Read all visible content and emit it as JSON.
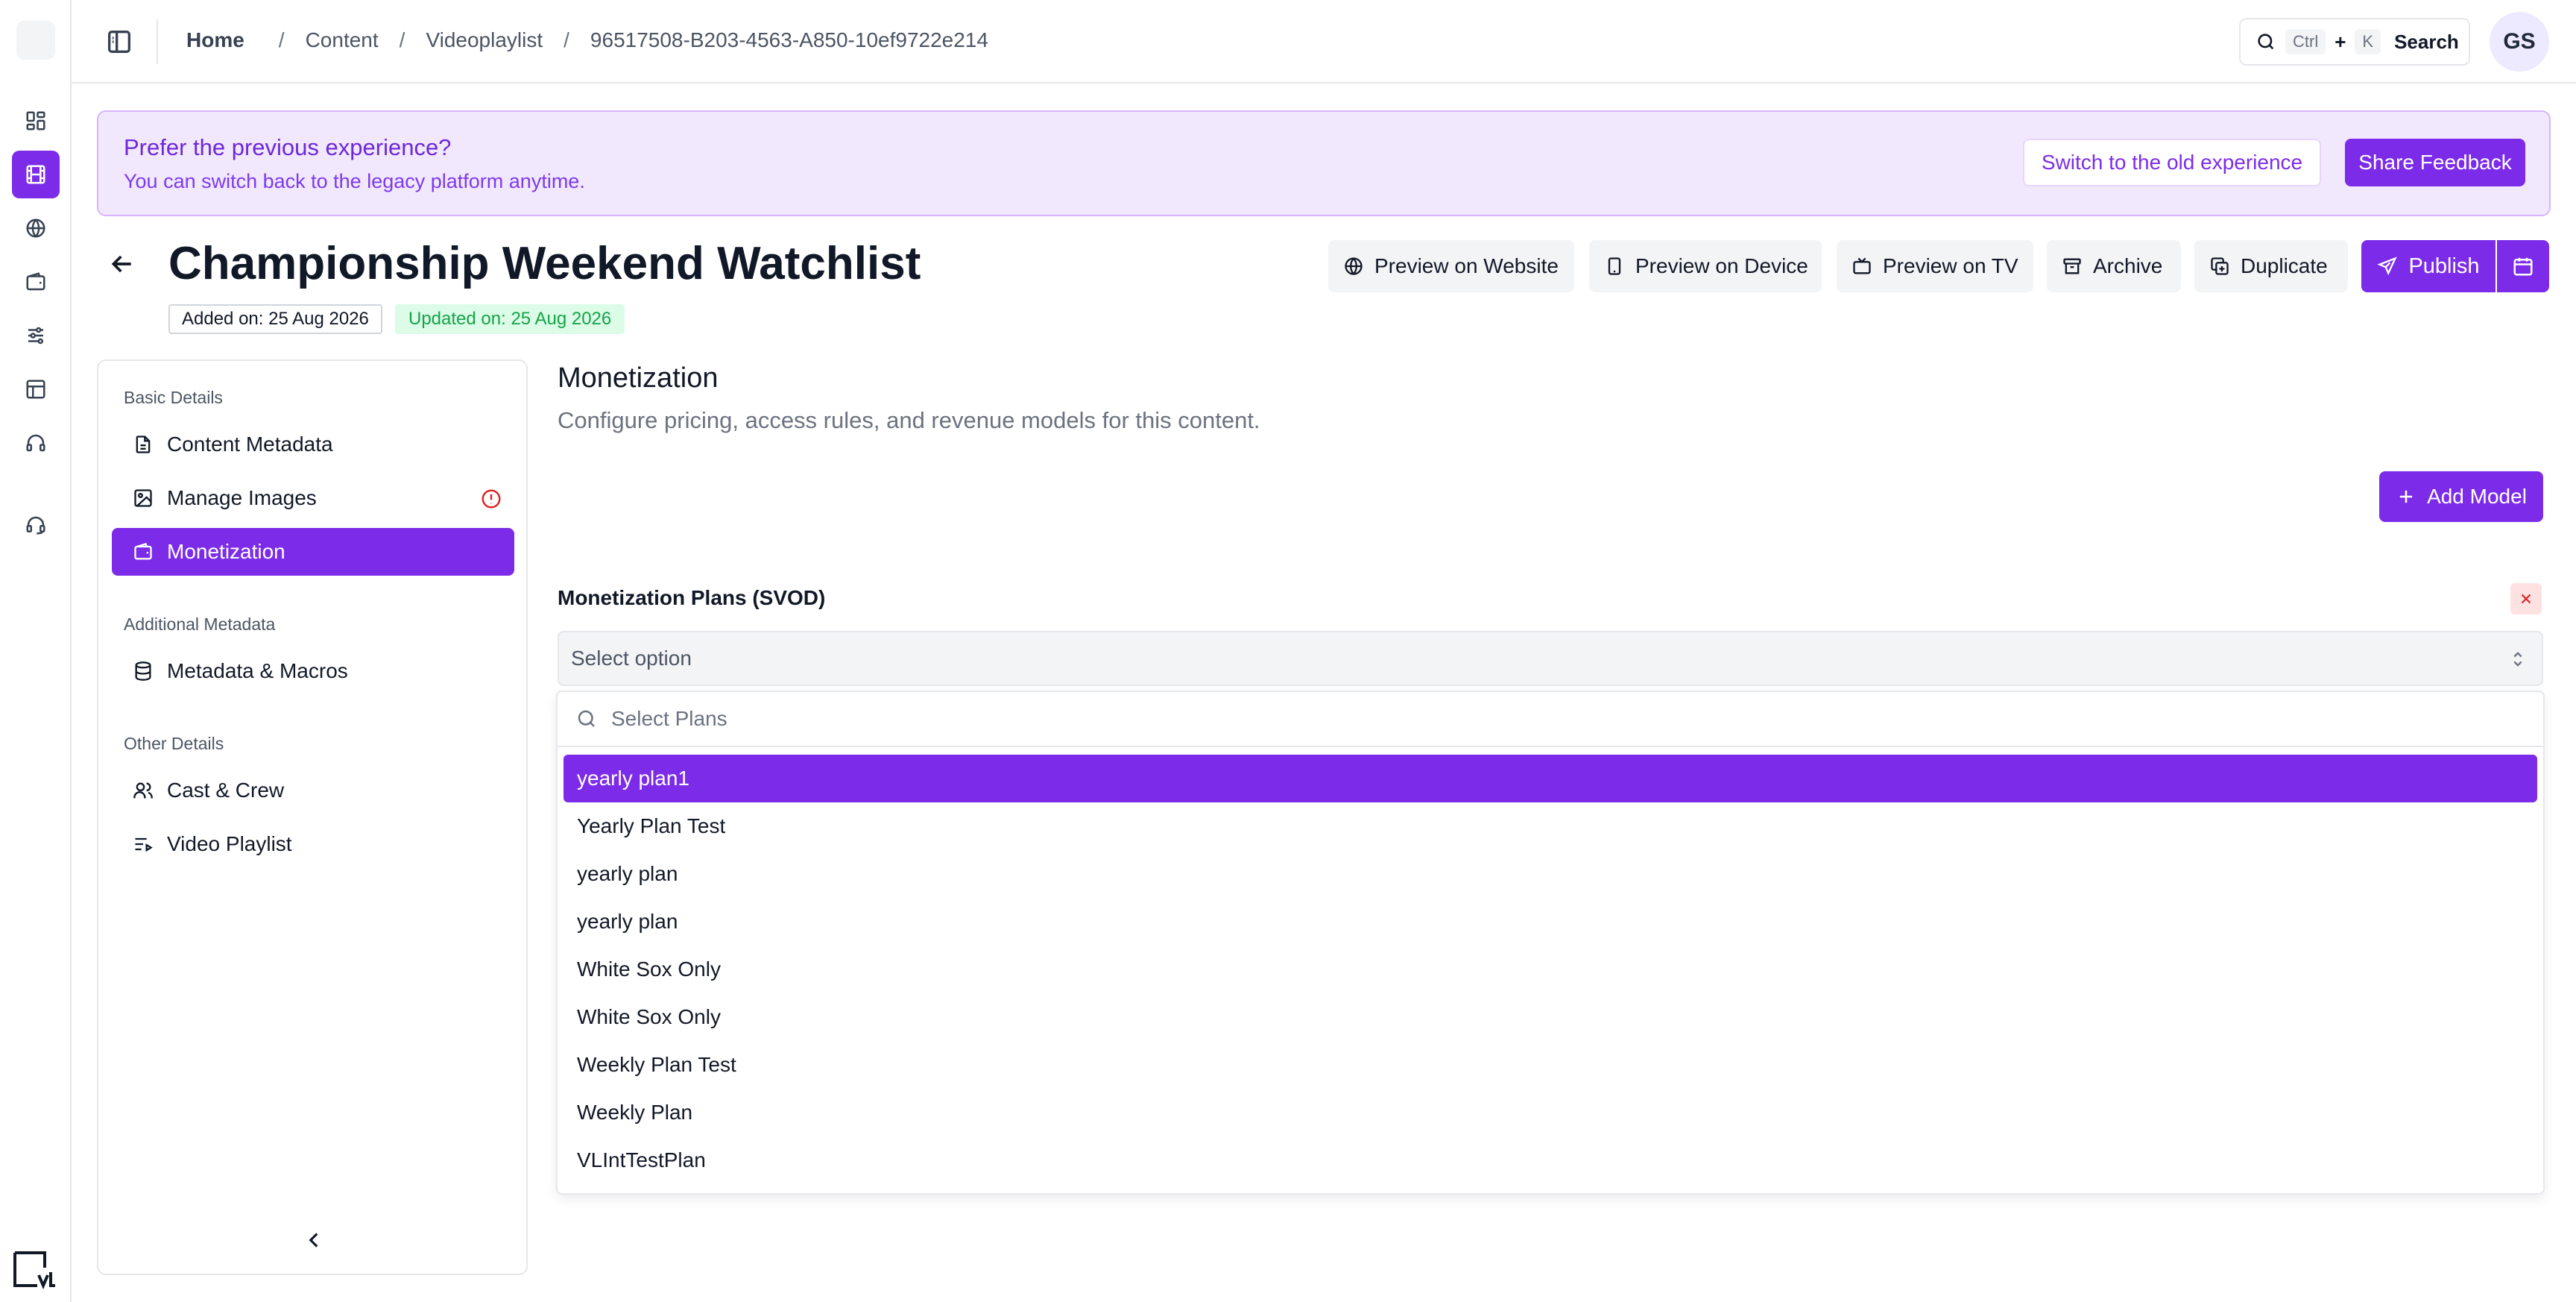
{
  "breadcrumb": {
    "home": "Home",
    "items": [
      "Content",
      "Videoplaylist",
      "96517508-B203-4563-A850-10ef9722e214"
    ]
  },
  "search": {
    "kbd_ctrl": "Ctrl",
    "plus": "+",
    "kbd_k": "K",
    "label": "Search"
  },
  "user": {
    "initials": "GS"
  },
  "banner": {
    "title": "Prefer the previous experience?",
    "subtitle": "You can switch back to the legacy platform anytime.",
    "switch_label": "Switch to the old experience",
    "feedback_label": "Share Feedback"
  },
  "header": {
    "title": "Championship Weekend Watchlist",
    "added": "Added on: 25 Aug 2026",
    "updated": "Updated on: 25 Aug 2026",
    "actions": {
      "preview_website": "Preview on Website",
      "preview_device": "Preview on Device",
      "preview_tv": "Preview on TV",
      "archive": "Archive",
      "duplicate": "Duplicate",
      "publish": "Publish"
    }
  },
  "nav": {
    "group_basic": "Basic Details",
    "content_metadata": "Content Metadata",
    "manage_images": "Manage Images",
    "monetization": "Monetization",
    "group_additional": "Additional Metadata",
    "metadata_macros": "Metadata & Macros",
    "group_other": "Other Details",
    "cast_crew": "Cast & Crew",
    "video_playlist": "Video Playlist"
  },
  "main": {
    "title": "Monetization",
    "description": "Configure pricing, access rules, and revenue models for this content.",
    "add_model": "Add Model",
    "plans_label": "Monetization Plans (SVOD)",
    "select_value": "Select option",
    "dropdown_placeholder": "Select Plans",
    "options": [
      "yearly plan1",
      "Yearly Plan Test",
      "yearly plan",
      "yearly plan",
      "White Sox Only",
      "White Sox Only",
      "Weekly Plan Test",
      "Weekly Plan",
      "VLIntTestPlan"
    ]
  },
  "colors": {
    "accent": "#7c2ce8",
    "banner_bg": "#f1e8fd",
    "success": "#16a34a",
    "danger": "#dc2626"
  }
}
